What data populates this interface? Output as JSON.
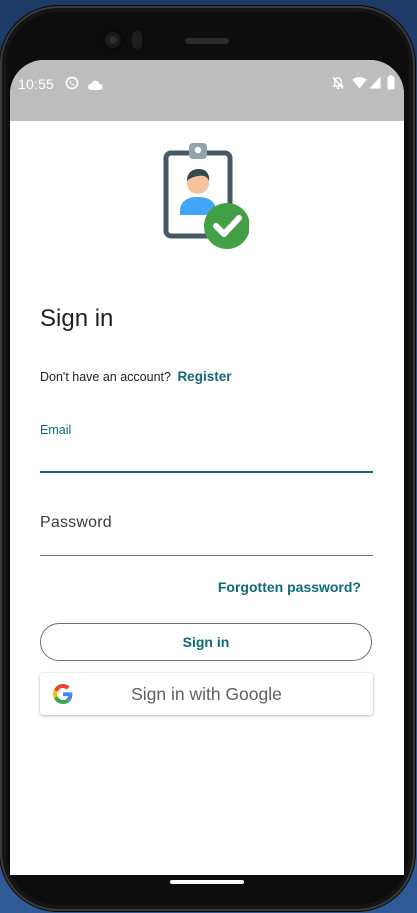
{
  "status_bar": {
    "time": "10:55",
    "left_icons": [
      "whatsapp-icon",
      "cloud-icon"
    ],
    "right_icons": [
      "notifications-off-icon",
      "wifi-icon",
      "signal-icon",
      "battery-icon"
    ]
  },
  "app": {
    "logo_icon": "id-badge-verified-icon",
    "title": "Sign in",
    "register_prompt": "Don't have an account?",
    "register_link": "Register",
    "email_label": "Email",
    "email_value": "",
    "password_label": "Password",
    "forgot_password": "Forgotten password?",
    "sign_in_button": "Sign in",
    "google_button": "Sign in with Google"
  },
  "colors": {
    "accent": "#0f6a78",
    "status_bar": "#bdbdbd",
    "check_green": "#43a047"
  }
}
